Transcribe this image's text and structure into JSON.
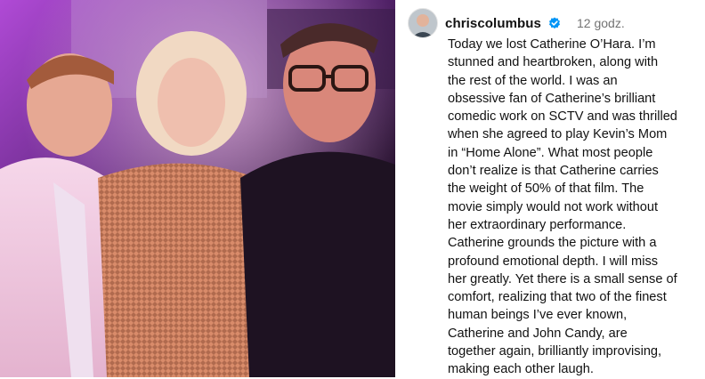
{
  "photo": {
    "alt_description_icon": "group-photo",
    "colors": {
      "stage_light": "#9b3fb8",
      "warm_light": "#e07a5f",
      "dark": "#1b0d1f"
    }
  },
  "post": {
    "username": "chriscolumbus",
    "verified_icon": "verified-badge-icon",
    "time": "12 godz.",
    "caption": "Today we lost Catherine O’Hara. I’m stunned and heartbroken, along with the rest of the world. I was an obsessive fan of Catherine’s brilliant comedic work on SCTV and was thrilled when she agreed to play Kevin’s Mom in “Home Alone”. What most people don’t realize is that Catherine carries the weight of 50% of that film. The movie simply would not work without her extraordinary performance. Catherine grounds the picture with a profound emotional depth. I will miss her greatly. Yet there is a small sense of comfort, realizing that two of the finest human beings I’ve ever known, Catherine and John Candy, are together again, brilliantly improvising, making each other laugh.",
    "accent_color": "#0095f6"
  }
}
